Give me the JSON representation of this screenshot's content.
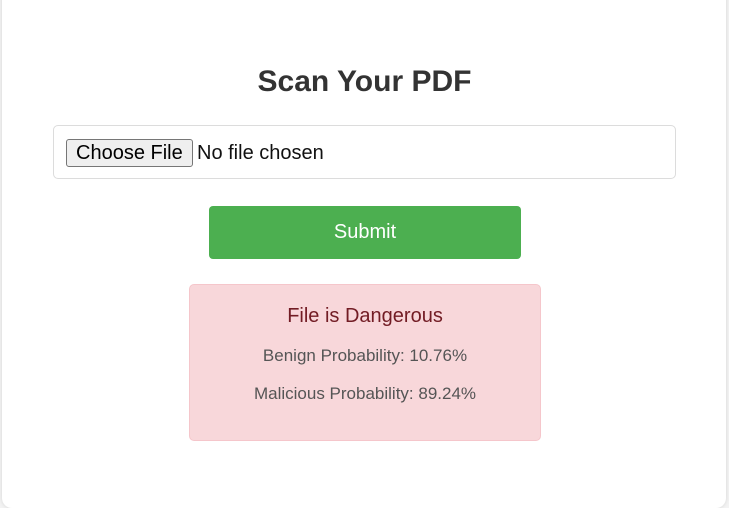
{
  "page": {
    "title": "Scan Your PDF"
  },
  "upload": {
    "choose_label": "Choose File",
    "status_text": "No file chosen"
  },
  "submit": {
    "label": "Submit",
    "color": "#4caf50"
  },
  "result": {
    "title": "File is Dangerous",
    "benign": "Benign Probability: 10.76%",
    "malicious": "Malicious Probability: 89.24%",
    "background_color": "#f8d7da",
    "text_color": "#721c24"
  }
}
